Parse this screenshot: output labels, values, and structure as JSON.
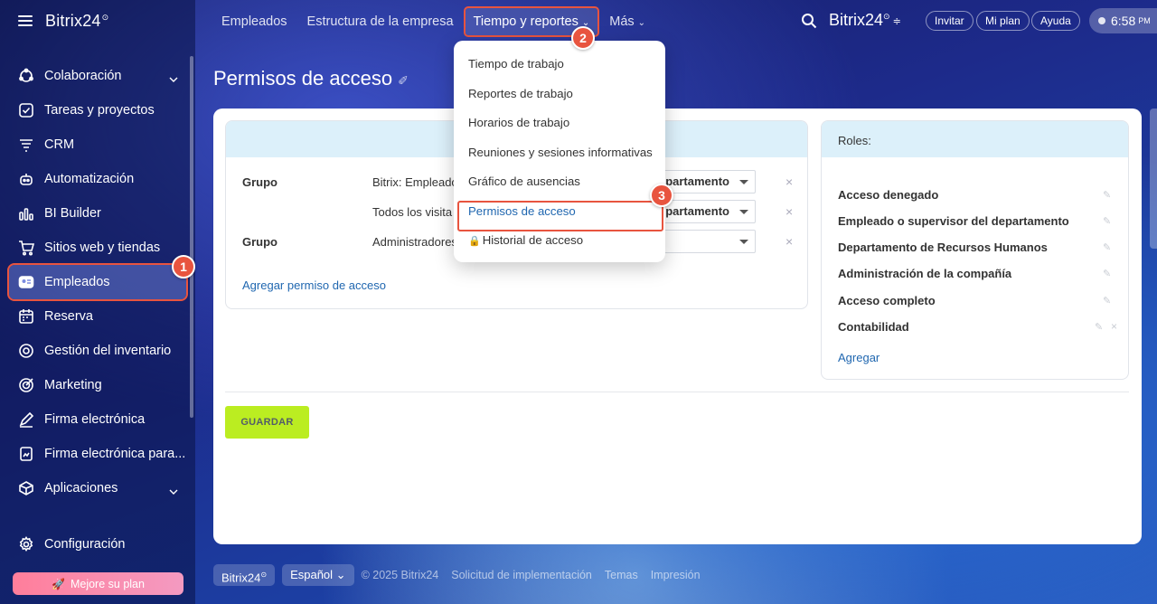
{
  "sidebar": {
    "logo": "Bitrix24",
    "items": [
      {
        "label": "Colaboración",
        "icon": "collaboration-icon",
        "chevron": true
      },
      {
        "label": "Tareas y proyectos",
        "icon": "tasks-icon"
      },
      {
        "label": "CRM",
        "icon": "crm-icon"
      },
      {
        "label": "Automatización",
        "icon": "automation-icon"
      },
      {
        "label": "BI Builder",
        "icon": "bi-builder-icon"
      },
      {
        "label": "Sitios web y tiendas",
        "icon": "cart-icon"
      },
      {
        "label": "Empleados",
        "icon": "employees-icon",
        "active": true
      },
      {
        "label": "Reserva",
        "icon": "calendar-icon"
      },
      {
        "label": "Gestión del inventario",
        "icon": "inventory-icon"
      },
      {
        "label": "Marketing",
        "icon": "marketing-icon"
      },
      {
        "label": "Firma electrónica",
        "icon": "signature-icon"
      },
      {
        "label": "Firma electrónica para...",
        "icon": "signature-doc-icon"
      },
      {
        "label": "Aplicaciones",
        "icon": "apps-icon",
        "chevron": true
      }
    ],
    "settings_label": "Configuración",
    "upgrade_label": "Mejore su plan"
  },
  "topbar": {
    "nav": [
      "Empleados",
      "Estructura de la empresa",
      "Tiempo y reportes",
      "Más"
    ],
    "brand": "Bitrix24",
    "invite": "Invitar",
    "my_plan": "Mi plan",
    "help": "Ayuda",
    "time": "6:58",
    "ampm": "PM"
  },
  "page": {
    "title": "Permisos de acceso"
  },
  "permissions": {
    "rows": [
      {
        "group": "Grupo",
        "who": "Bitrix: Empleado",
        "role": "Empleado o supervisor del departamento"
      },
      {
        "group": "",
        "who": "Todos los visita",
        "role": "Empleado o supervisor del departamento"
      },
      {
        "group": "Grupo",
        "who": "Administradores",
        "role": ""
      }
    ],
    "add_label": "Agregar permiso de acceso"
  },
  "roles": {
    "header": "Roles:",
    "items": [
      "Acceso denegado",
      "Empleado o supervisor del departamento",
      "Departamento de Recursos Humanos",
      "Administración de la compañía",
      "Acceso completo",
      "Contabilidad"
    ],
    "add_label": "Agregar"
  },
  "save_label": "GUARDAR",
  "dropdown": {
    "items": [
      "Tiempo de trabajo",
      "Reportes de trabajo",
      "Horarios de trabajo",
      "Reuniones y sesiones informativas",
      "Gráfico de ausencias",
      "Permisos de acceso",
      "Historial de acceso"
    ],
    "active_index": 5
  },
  "badges": [
    "1",
    "2",
    "3"
  ],
  "footer": {
    "brand": "Bitrix24",
    "language": "Español",
    "copyright": "© 2025 Bitrix24",
    "links": [
      "Solicitud de implementación",
      "Temas",
      "Impresión"
    ]
  },
  "colors": {
    "accent_red": "#e8543f",
    "save_green": "#bbed21",
    "link_blue": "#2067b0"
  }
}
